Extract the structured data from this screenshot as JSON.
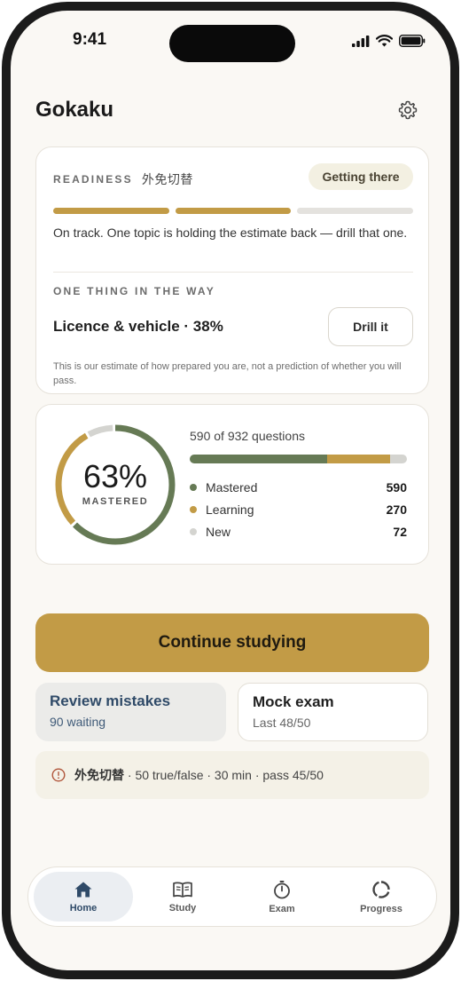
{
  "status": {
    "time": "9:41"
  },
  "app": {
    "title": "Gokaku"
  },
  "readiness": {
    "eyebrow": "READINESS",
    "exam_name": "外免切替",
    "badge": "Getting there",
    "segments_filled": 2,
    "segments_total": 3,
    "message": "On track. One topic is holding the estimate back — drill that one.",
    "blocker_eyebrow": "ONE THING IN THE WAY",
    "blocker_topic": "Licence & vehicle · 38%",
    "drill_label": "Drill it",
    "disclaimer": "This is our estimate of how prepared you are, not a prediction of whether you will pass."
  },
  "mastery": {
    "percent": "63%",
    "label": "MASTERED",
    "questions_summary": "590 of 932 questions",
    "total": 932,
    "categories": [
      {
        "name": "Mastered",
        "value": 590,
        "color": "#667a55"
      },
      {
        "name": "Learning",
        "value": 270,
        "color": "#c29b46"
      },
      {
        "name": "New",
        "value": 72,
        "color": "#d4d4d0"
      }
    ]
  },
  "actions": {
    "continue_label": "Continue studying",
    "review_title": "Review mistakes",
    "review_sub": "90 waiting",
    "mock_title": "Mock exam",
    "mock_sub": "Last 48/50"
  },
  "info": {
    "icon": "info-circle-icon",
    "exam_name": "外免切替",
    "details": "· 50 true/false · 30 min · pass 45/50"
  },
  "tabs": [
    {
      "label": "Home",
      "icon": "home-icon",
      "active": true
    },
    {
      "label": "Study",
      "icon": "book-icon",
      "active": false
    },
    {
      "label": "Exam",
      "icon": "stopwatch-icon",
      "active": false
    },
    {
      "label": "Progress",
      "icon": "progress-ring-icon",
      "active": false
    }
  ],
  "colors": {
    "accent": "#c29b46",
    "mastered": "#667a55",
    "new": "#d4d4d0",
    "review_text": "#2f4a68",
    "info_icon": "#b0553a"
  }
}
